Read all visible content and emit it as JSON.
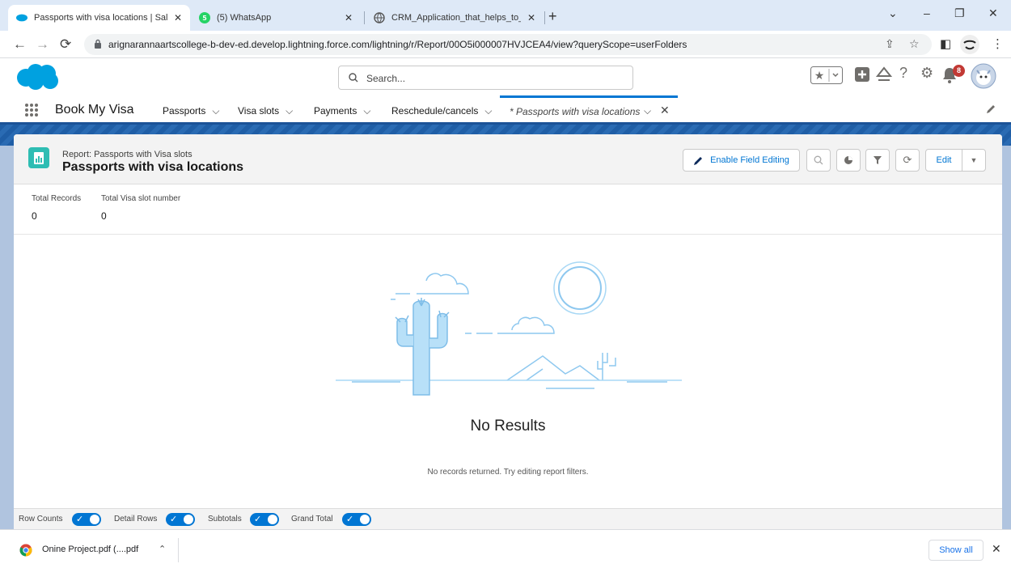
{
  "browser": {
    "tabs": [
      {
        "label": "Passports with visa locations | Sal",
        "active": true
      },
      {
        "label": "(5) WhatsApp",
        "active": false
      },
      {
        "label": "CRM_Application_that_helps_to_",
        "active": false
      }
    ],
    "new_tab_symbol": "+",
    "url": "arignarannaartscollege-b-dev-ed.develop.lightning.force.com/lightning/r/Report/00O5i000007HVJCEA4/view?queryScope=userFolders",
    "whatsapp_badge": "5"
  },
  "header": {
    "search_placeholder": "Search...",
    "notification_count": "8"
  },
  "app_nav": {
    "app_name": "Book My Visa",
    "items": [
      {
        "label": "Passports"
      },
      {
        "label": "Visa slots"
      },
      {
        "label": "Payments"
      },
      {
        "label": "Reschedule/cancels"
      }
    ],
    "active_tab": "* Passports with visa locations"
  },
  "report": {
    "subtitle": "Report: Passports with Visa slots",
    "title": "Passports with visa locations",
    "enable_field_editing": "Enable Field Editing",
    "edit_label": "Edit",
    "summary": [
      {
        "label": "Total Records",
        "value": "0"
      },
      {
        "label": "Total Visa slot number",
        "value": "0"
      }
    ],
    "empty_title": "No Results",
    "empty_message": "No records returned. Try editing report filters."
  },
  "footer_toggles": [
    {
      "label": "Row Counts",
      "on": true
    },
    {
      "label": "Detail Rows",
      "on": true
    },
    {
      "label": "Subtotals",
      "on": true
    },
    {
      "label": "Grand Total",
      "on": true
    }
  ],
  "downloads": {
    "file_name": "Onine Project.pdf (....pdf",
    "show_all": "Show all"
  },
  "colors": {
    "brand_blue": "#0176d3",
    "header_blue": "#1b5297",
    "report_icon": "#2ebdb3",
    "salesforce_cloud": "#00a1e0",
    "notification": "#c23934"
  }
}
